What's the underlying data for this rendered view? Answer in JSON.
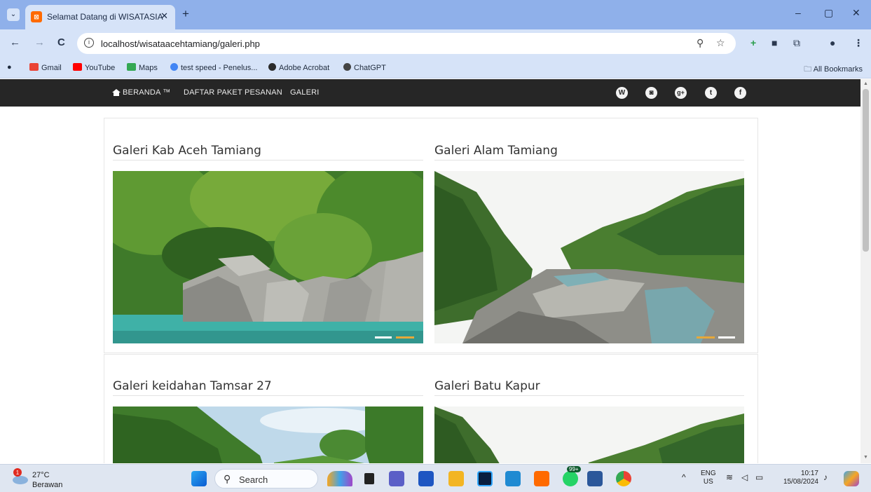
{
  "browser": {
    "tab_title": "Selamat Datang di WISATASIA",
    "tab_favicon": "⊠",
    "tab_close": "✕",
    "new_tab": "+",
    "menu_icon": "⌄",
    "url": "localhost/wisataacehtamiang/galeri.php",
    "window_controls": [
      "–",
      "▢",
      "✕"
    ],
    "nav": {
      "back": "←",
      "forward": "→",
      "reload": "C"
    },
    "bookmarks": [
      {
        "label": "Gmail",
        "color": "#ea4335"
      },
      {
        "label": "YouTube",
        "color": "#ff0000"
      },
      {
        "label": "Maps",
        "color": "#34a853"
      },
      {
        "label": "test speed - Penelus...",
        "color": "#4285f4"
      },
      {
        "label": "Adobe Acrobat",
        "color": "#2b2b2b"
      },
      {
        "label": "ChatGPT",
        "color": "#444444"
      }
    ],
    "all_bookmarks": "All Bookmarks"
  },
  "site": {
    "nav": {
      "home": "BERANDA ™",
      "packages": "DAFTAR PAKET PESANAN",
      "gallery": "GALERI"
    },
    "social": [
      {
        "name": "wordpress-icon",
        "glyph": "W"
      },
      {
        "name": "instagram-icon",
        "glyph": "◙"
      },
      {
        "name": "googleplus-icon",
        "glyph": "g+"
      },
      {
        "name": "twitter-icon",
        "glyph": "t"
      },
      {
        "name": "facebook-icon",
        "glyph": "f"
      }
    ],
    "galleries": [
      {
        "title": "Galeri Kab Aceh Tamiang"
      },
      {
        "title": "Galeri Alam Tamiang"
      },
      {
        "title": "Galeri keidahan Tamsar 27"
      },
      {
        "title": "Galeri Batu Kapur"
      }
    ],
    "accent_color": "#e6a83a"
  },
  "taskbar": {
    "weather_temp": "27°C",
    "weather_desc": "Berawan",
    "weather_badge": "1",
    "search_label": "Search",
    "lang_top": "ENG",
    "lang_bottom": "US",
    "time": "10:17",
    "date": "15/08/2024",
    "teams_badge": "99+"
  }
}
